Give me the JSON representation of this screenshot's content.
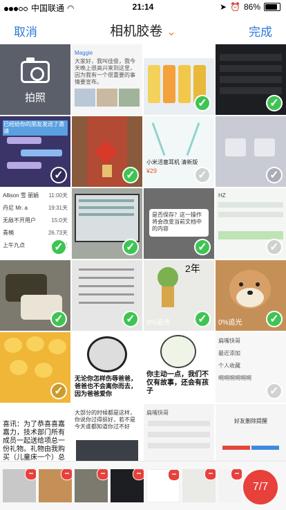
{
  "status": {
    "carrier": "中国联通",
    "time": "21:14",
    "battery": "86%",
    "battery_level": 0.86
  },
  "nav": {
    "cancel": "取消",
    "title": "相机胶卷",
    "done": "完成"
  },
  "camera": {
    "label": "拍照"
  },
  "cells": {
    "c2": {
      "name": "Maggie",
      "text": "大家好，我叫佳俊，我今天晚上很高兴来到这里，因为我有一个很重要的事情要宣布。"
    },
    "c4": {
      "text": ""
    },
    "c5": {
      "text": "已经给你的朋友发送了邀请"
    },
    "c7": {
      "text": "小米活塞耳机 清新版",
      "price": "¥29"
    },
    "c9": {
      "rows": [
        "Allison 雪 丽娟",
        "11:00天",
        "丹尼 Mr. a",
        "19:31天",
        "无敌不开用户",
        "15:0天",
        "青楠",
        "26.73天",
        "上午九点",
        "16:7天"
      ]
    },
    "c11": {
      "text": "是否保存？这一操作将会改变当前文档中的内容"
    },
    "c12": {
      "text": "HZ"
    },
    "c15": {
      "text": "0%追光",
      "year": "2年"
    },
    "c16": {
      "text": "0%追光"
    },
    "c18": {
      "text": "无论你怎样伤辱爸爸，爸爸也不会离你而去，因为爸爸爱你"
    },
    "c19": {
      "text": "你主动一点，我们不仅有故事，还会有孩子"
    },
    "c20": {
      "rows": [
        "扁嘴快哥",
        "最近添加",
        "个人收藏",
        "啊啊啊啊啊啊"
      ]
    },
    "c21": {
      "text": "喜讯：为了恭喜喜嘉嘉力，技术部门所有成员一起送给项总一份礼物。礼物由我购买（儿童床一个）总价值526元整，平均一人21元！"
    },
    "c22": {
      "text": "大部分的时候都是这样，你说你过得挺好，若不是今天谁都知道你过不好"
    },
    "c23": {
      "text": "扁嘴快哥"
    },
    "c24": {
      "text": "好友删除提醒"
    }
  },
  "bottom": {
    "counter": "7/7"
  },
  "colors": {
    "accent": "#2b78d7",
    "check": "#3fc453",
    "delete": "#e8403a"
  },
  "icons": [
    "camera-icon",
    "check-icon",
    "delete-icon",
    "chevron-down-icon",
    "wifi-icon",
    "battery-icon",
    "alarm-icon",
    "location-icon"
  ]
}
